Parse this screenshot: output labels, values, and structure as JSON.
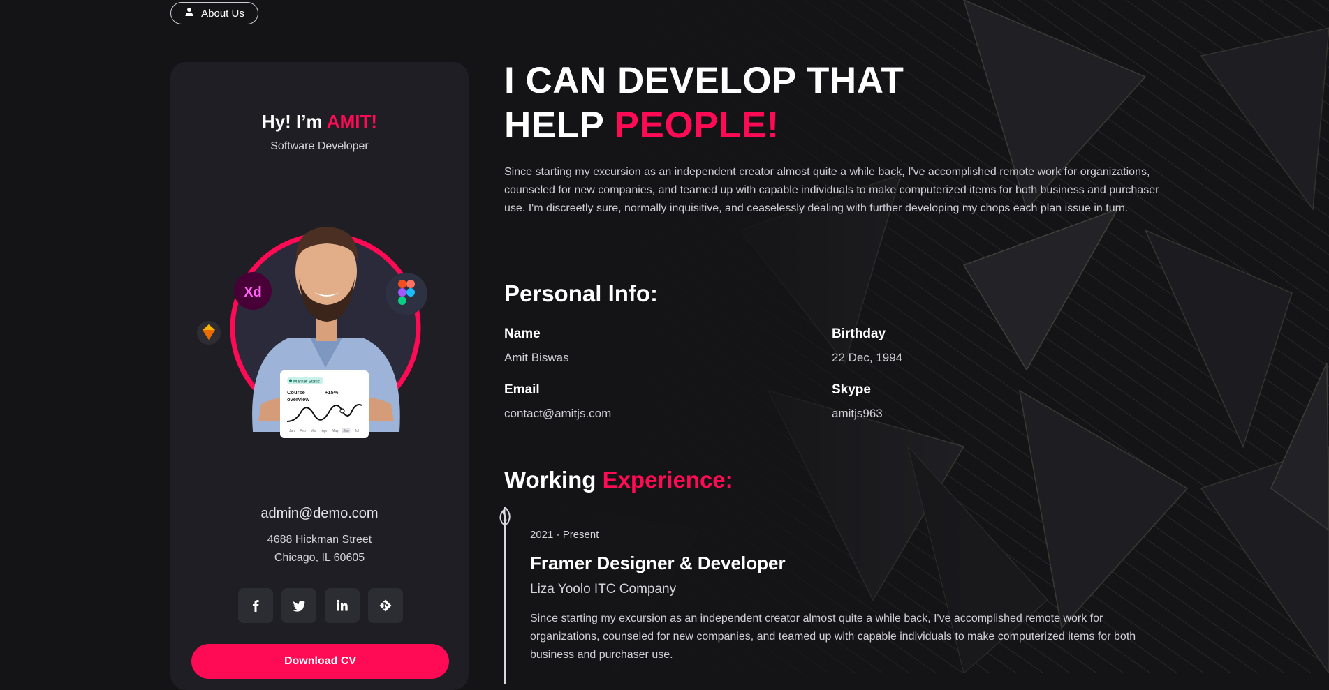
{
  "about_button": {
    "label": "About Us",
    "icon": "user-icon"
  },
  "profile": {
    "greeting_prefix": "Hy! I’m ",
    "greeting_name": "AMIT!",
    "role": "Software Developer",
    "email": "admin@demo.com",
    "address_line1": "4688 Hickman Street",
    "address_line2": "Chicago, IL 60605",
    "socials": [
      {
        "icon": "facebook-icon"
      },
      {
        "icon": "twitter-icon"
      },
      {
        "icon": "linkedin-icon"
      },
      {
        "icon": "git-icon"
      }
    ],
    "download_label": "Download CV",
    "card_widget": {
      "badge": "Market Static",
      "title_line1": "Course",
      "title_line2": "overview",
      "change": "+15%",
      "months": [
        "Jan",
        "Feb",
        "Mar",
        "Apr",
        "May",
        "Jun",
        "Jul"
      ]
    }
  },
  "hero": {
    "line1": "I CAN DEVELOP THAT",
    "line2_prefix": "HELP ",
    "line2_accent": "PEOPLE!",
    "intro": "Since starting my excursion as an independent creator almost quite a while back, I've accomplished remote work for organizations, counseled for new companies, and teamed up with capable individuals to make computerized items for both business and purchaser use. I'm discreetly sure, normally inquisitive, and ceaselessly dealing with further developing my chops each plan issue in turn."
  },
  "personal_info": {
    "title": "Personal Info:",
    "name_label": "Name",
    "name_value": "Amit Biswas",
    "birthday_label": "Birthday",
    "birthday_value": "22 Dec, 1994",
    "email_label": "Email",
    "email_value": "contact@amitjs.com",
    "skype_label": "Skype",
    "skype_value": "amitjs963"
  },
  "experience": {
    "title_prefix": "Working ",
    "title_accent": "Experience:",
    "items": [
      {
        "period": "2021 - Present",
        "title": "Framer Designer & Developer",
        "company": "Liza Yoolo ITC Company",
        "description": "Since starting my excursion as an independent creator almost quite a while back, I've accomplished remote work for organizations, counseled for new companies, and teamed up with capable individuals to make computerized items for both business and purchaser use."
      }
    ]
  },
  "colors": {
    "accent": "#ff0a54",
    "background": "#141416",
    "card": "#1e1e24",
    "social_bg": "#2c2c33"
  }
}
